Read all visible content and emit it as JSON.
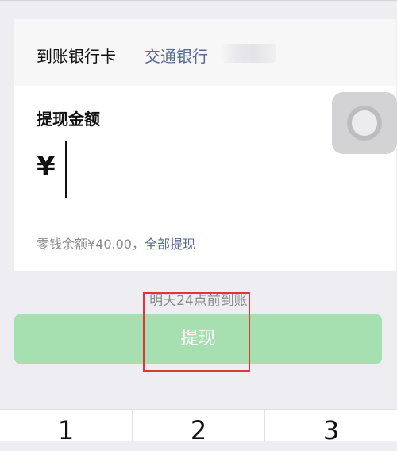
{
  "withdraw_form": {
    "bank_label": "到账银行卡",
    "bank_name": "交通银行",
    "amount_label": "提现金额",
    "currency_symbol": "¥",
    "amount_value": "",
    "balance_text": "零钱余额¥40.00，",
    "withdraw_all_label": "全部提现"
  },
  "arrival_note": "明天24点前到账",
  "submit_label": "提现",
  "keypad": {
    "keys": [
      "1",
      "2",
      "3"
    ]
  },
  "colors": {
    "background": "#eeedf2",
    "link": "#576b95",
    "button_disabled": "#a6e0b1",
    "highlight_box": "#e0353a"
  }
}
